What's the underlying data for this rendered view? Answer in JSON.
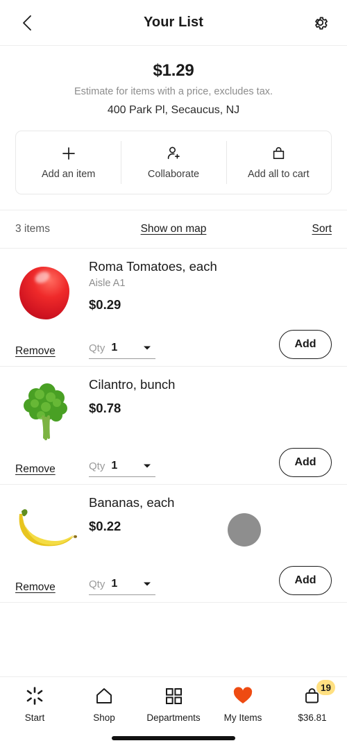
{
  "header": {
    "title": "Your List",
    "back_icon": "chevron-left-icon",
    "settings_icon": "gear-icon"
  },
  "summary": {
    "total": "$1.29",
    "note": "Estimate for items with a price, excludes tax.",
    "store": "400 Park Pl, Secaucus, NJ"
  },
  "quick_actions": [
    {
      "label": "Add an item",
      "icon": "plus-icon"
    },
    {
      "label": "Collaborate",
      "icon": "person-add-icon"
    },
    {
      "label": "Add all to cart",
      "icon": "shopping-bag-icon"
    }
  ],
  "list_meta": {
    "count": "3 items",
    "show_on_map": "Show on map",
    "sort": "Sort"
  },
  "items": [
    {
      "name": "Roma Tomatoes, each",
      "aisle": "Aisle A1",
      "price": "$0.29",
      "remove_label": "Remove",
      "qty_label": "Qty",
      "qty_value": "1",
      "add_label": "Add",
      "image": "tomato-image"
    },
    {
      "name": "Cilantro, bunch",
      "aisle": "",
      "price": "$0.78",
      "remove_label": "Remove",
      "qty_label": "Qty",
      "qty_value": "1",
      "add_label": "Add",
      "image": "cilantro-image"
    },
    {
      "name": "Bananas, each",
      "aisle": "",
      "price": "$0.22",
      "remove_label": "Remove",
      "qty_label": "Qty",
      "qty_value": "1",
      "add_label": "Add",
      "image": "banana-image"
    }
  ],
  "bottom_nav": [
    {
      "label": "Start",
      "icon": "spark-icon"
    },
    {
      "label": "Shop",
      "icon": "home-icon"
    },
    {
      "label": "Departments",
      "icon": "grid-icon"
    },
    {
      "label": "My Items",
      "icon": "heart-icon"
    },
    {
      "label": "$36.81",
      "icon": "cart-bag-icon",
      "badge": "19"
    }
  ],
  "colors": {
    "heart": "#ee4b12",
    "badge": "#ffe081",
    "text": "#1a1a1a",
    "muted": "#8d8d8d",
    "divider": "#ededed"
  }
}
